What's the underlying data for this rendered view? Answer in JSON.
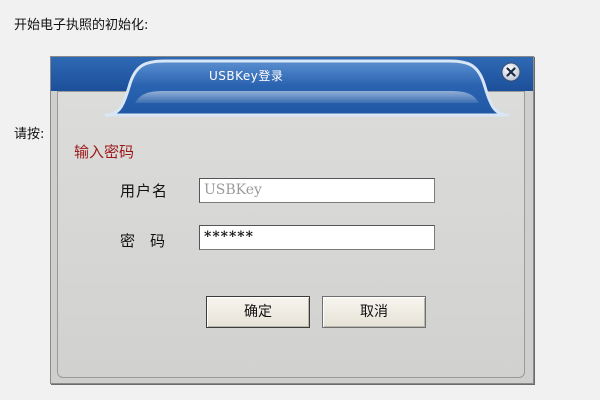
{
  "background": {
    "intro_text": "开始电子执照的初始化:",
    "prompt_text": "请按:"
  },
  "dialog": {
    "title": "USBKey登录",
    "close_icon": "close-icon",
    "section_title": "输入密码",
    "username_label": "用户名",
    "username_value": "USBKey",
    "password_label": "密码",
    "password_value": "******",
    "ok_label": "确定",
    "cancel_label": "取消"
  },
  "colors": {
    "title_band": "#2f69b4",
    "section_title": "#9c1a1a",
    "dialog_body": "#d6d6d4"
  }
}
